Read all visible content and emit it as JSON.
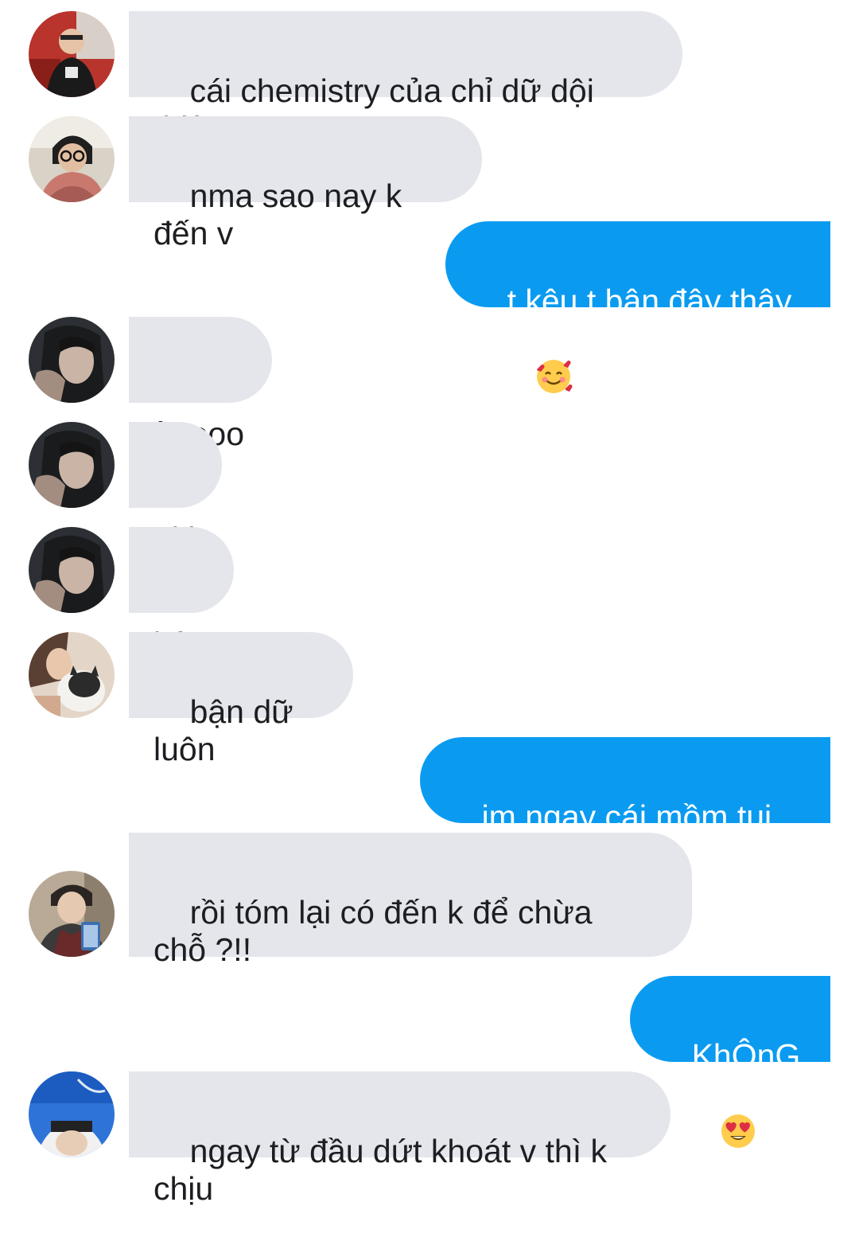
{
  "colors": {
    "incoming_bubble": "#e4e6eb",
    "outgoing_bubble": "#0a9bf0",
    "incoming_text": "#1c1e21",
    "outgoing_text": "#ffffff"
  },
  "messages": [
    {
      "direction": "incoming",
      "avatar": "avatar-red-jacket",
      "text": "cái chemistry của chỉ dữ dội thiệc"
    },
    {
      "direction": "incoming",
      "avatar": "avatar-glasses",
      "text": "nma sao nay k đến v"
    },
    {
      "direction": "outgoing",
      "text": "t kêu t bận đây thây",
      "emoji": "smiling-face-with-hearts"
    },
    {
      "direction": "incoming",
      "avatar": "avatar-girl-dark",
      "text": "òoooo"
    },
    {
      "direction": "incoming",
      "avatar": "avatar-girl-dark",
      "text": "uki"
    },
    {
      "direction": "incoming",
      "avatar": "avatar-girl-dark",
      "text": "bận"
    },
    {
      "direction": "incoming",
      "avatar": "avatar-girl-cat",
      "text": "bận dữ luôn"
    },
    {
      "direction": "outgoing",
      "text": "im ngay cái mồm tụi bây"
    },
    {
      "direction": "incoming",
      "avatar": "avatar-boy-phone",
      "text": "rồi tóm lại có đến k để chừa\nchỗ ?!!"
    },
    {
      "direction": "outgoing",
      "text": "KhÔnG",
      "emoji": "heart-eyes"
    },
    {
      "direction": "incoming",
      "avatar": "avatar-sky",
      "text": "ngay từ đầu dứt khoát v thì k chịu"
    }
  ]
}
